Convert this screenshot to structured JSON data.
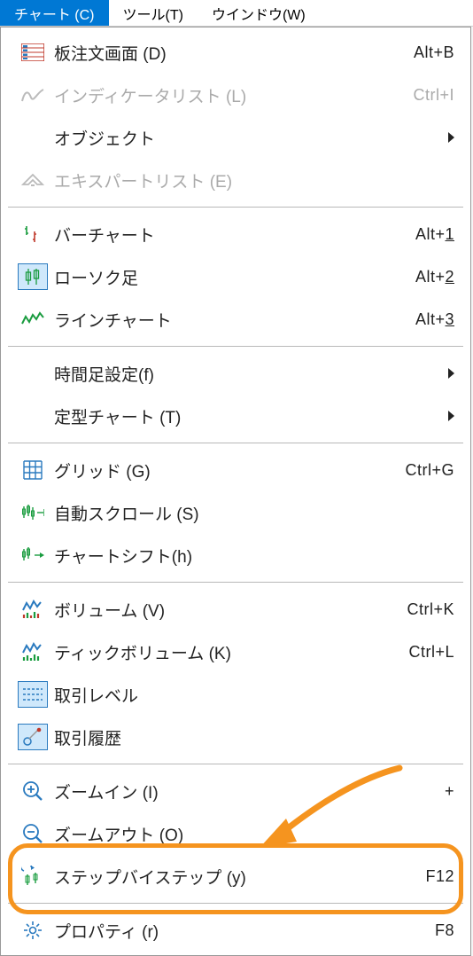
{
  "menubar": {
    "items": [
      {
        "label": "チャート (C)",
        "active": true
      },
      {
        "label": "ツール(T)",
        "active": false
      },
      {
        "label": "ウインドウ(W)",
        "active": false
      }
    ]
  },
  "menu": {
    "order_book": {
      "label": "板注文画面 (D)",
      "shortcut": "Alt+B"
    },
    "indicator_list": {
      "label": "インディケータリスト (L)",
      "shortcut": "Ctrl+I"
    },
    "objects": {
      "label": "オブジェクト"
    },
    "expert_list": {
      "label": "エキスパートリスト (E)"
    },
    "bar_chart": {
      "label": "バーチャート",
      "shortcut_prefix": "Alt+",
      "shortcut_key": "1"
    },
    "candlestick": {
      "label": "ローソク足",
      "shortcut_prefix": "Alt+",
      "shortcut_key": "2"
    },
    "line_chart": {
      "label": "ラインチャート",
      "shortcut_prefix": "Alt+",
      "shortcut_key": "3"
    },
    "timeframe": {
      "label": "時間足設定(f)"
    },
    "template": {
      "label": "定型チャート (T)"
    },
    "grid": {
      "label": "グリッド (G)",
      "shortcut": "Ctrl+G"
    },
    "autoscroll": {
      "label": "自動スクロール (S)"
    },
    "chart_shift": {
      "label": "チャートシフト(h)"
    },
    "volume": {
      "label": "ボリューム (V)",
      "shortcut": "Ctrl+K"
    },
    "tick_volume": {
      "label": "ティックボリューム (K)",
      "shortcut": "Ctrl+L"
    },
    "trade_levels": {
      "label": "取引レベル"
    },
    "trade_history": {
      "label": "取引履歴"
    },
    "zoom_in": {
      "label": "ズームイン (I)",
      "shortcut": "+"
    },
    "zoom_out": {
      "label": "ズームアウト (O)"
    },
    "step_by_step": {
      "label": "ステップバイステップ (y)",
      "shortcut": "F12"
    },
    "properties": {
      "label": "プロパティ (r)",
      "shortcut": "F8"
    }
  }
}
